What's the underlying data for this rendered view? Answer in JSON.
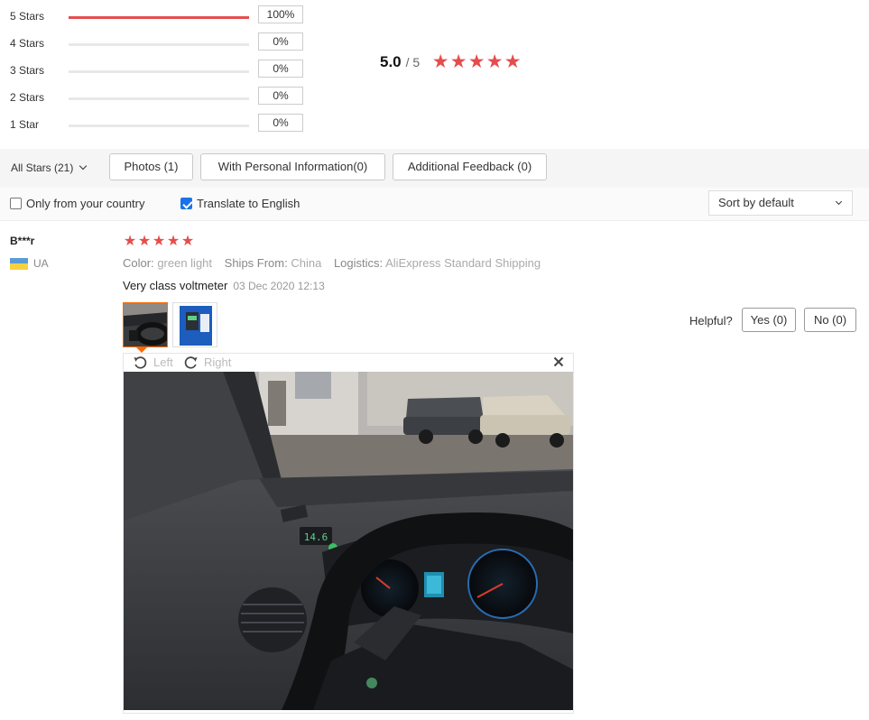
{
  "ratings": [
    {
      "label": "5 Stars",
      "percent": "100%",
      "fill": 1.0
    },
    {
      "label": "4 Stars",
      "percent": "0%",
      "fill": 0
    },
    {
      "label": "3 Stars",
      "percent": "0%",
      "fill": 0
    },
    {
      "label": "2 Stars",
      "percent": "0%",
      "fill": 0
    },
    {
      "label": "1 Star",
      "percent": "0%",
      "fill": 0
    }
  ],
  "overall": {
    "score": "5.0",
    "out_of": "/ 5",
    "stars": 5
  },
  "filters": {
    "all_stars": "All Stars (21)",
    "photos": "Photos (1)",
    "personal_info": "With Personal Information(0)",
    "additional": "Additional Feedback (0)"
  },
  "options": {
    "only_country": "Only from your country",
    "only_country_checked": false,
    "translate": "Translate to English",
    "translate_checked": true,
    "sort": "Sort by default"
  },
  "review": {
    "name": "B***r",
    "country": "UA",
    "stars": 5,
    "color_label": "Color:",
    "color_value": "green light",
    "ships_label": "Ships From:",
    "ships_value": "China",
    "logistics_label": "Logistics:",
    "logistics_value": "AliExpress Standard Shipping",
    "text": "Very class voltmeter",
    "date": "03 Dec 2020 12:13",
    "helpful_label": "Helpful?",
    "yes_label": "Yes (0)",
    "no_label": "No (0)",
    "photo_count": 2
  },
  "viewer": {
    "rotate_left": "Left",
    "rotate_right": "Right",
    "voltmeter_reading": "14.6"
  },
  "colors": {
    "accent_red": "#e54d4d",
    "active_orange": "#ff6a00",
    "check_blue": "#1a73e8"
  }
}
